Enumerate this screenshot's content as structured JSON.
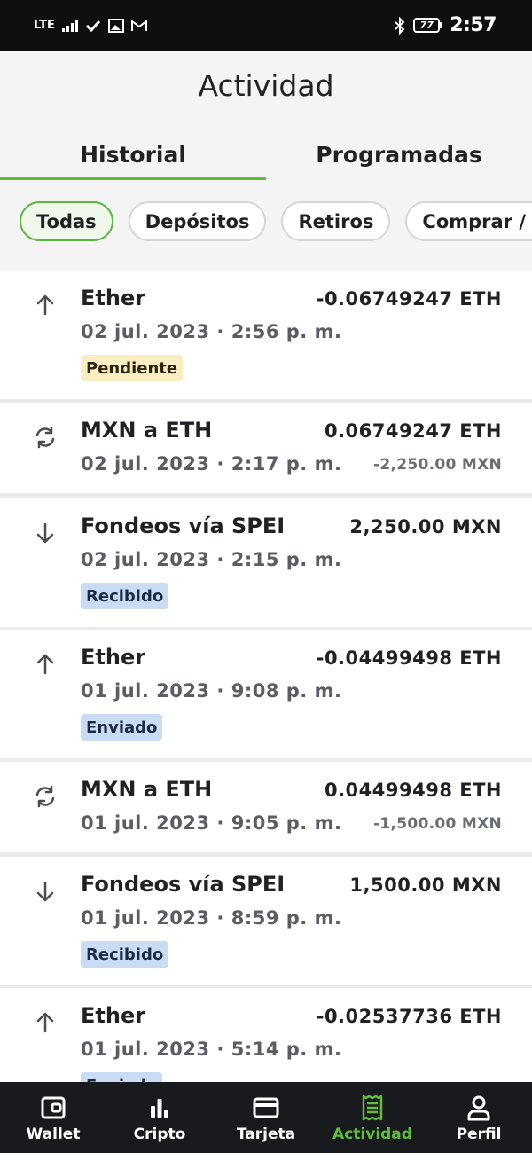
{
  "status_bar": {
    "network": "LTE",
    "battery": "77",
    "time": "2:57"
  },
  "header": {
    "title": "Actividad"
  },
  "tabs": [
    {
      "label": "Historial",
      "active": true
    },
    {
      "label": "Programadas",
      "active": false
    }
  ],
  "filters": [
    {
      "label": "Todas",
      "active": true
    },
    {
      "label": "Depósitos",
      "active": false
    },
    {
      "label": "Retiros",
      "active": false
    },
    {
      "label": "Comprar / Vender",
      "active": false
    }
  ],
  "transactions": [
    {
      "icon": "arrow-up-icon",
      "title": "Ether",
      "date": "02 jul. 2023 · 2:56 p. m.",
      "amount": "-0.06749247 ETH",
      "sub_amount": "",
      "status": "Pendiente"
    },
    {
      "icon": "exchange-icon",
      "title": "MXN a ETH",
      "date": "02 jul. 2023 · 2:17 p. m.",
      "amount": "0.06749247 ETH",
      "sub_amount": "-2,250.00 MXN",
      "status": ""
    },
    {
      "icon": "arrow-down-icon",
      "title": "Fondeos vía SPEI",
      "date": "02 jul. 2023 · 2:15 p. m.",
      "amount": "2,250.00 MXN",
      "sub_amount": "",
      "status": "Recibido"
    },
    {
      "icon": "arrow-up-icon",
      "title": "Ether",
      "date": "01 jul. 2023 · 9:08 p. m.",
      "amount": "-0.04499498 ETH",
      "sub_amount": "",
      "status": "Enviado"
    },
    {
      "icon": "exchange-icon",
      "title": "MXN a ETH",
      "date": "01 jul. 2023 · 9:05 p. m.",
      "amount": "0.04499498 ETH",
      "sub_amount": "-1,500.00 MXN",
      "status": ""
    },
    {
      "icon": "arrow-down-icon",
      "title": "Fondeos vía SPEI",
      "date": "01 jul. 2023 · 8:59 p. m.",
      "amount": "1,500.00 MXN",
      "sub_amount": "",
      "status": "Recibido"
    },
    {
      "icon": "arrow-up-icon",
      "title": "Ether",
      "date": "01 jul. 2023 · 5:14 p. m.",
      "amount": "-0.02537736 ETH",
      "sub_amount": "",
      "status": "Enviado"
    }
  ],
  "bottom_nav": [
    {
      "icon": "wallet-icon",
      "label": "Wallet",
      "active": false
    },
    {
      "icon": "chart-icon",
      "label": "Cripto",
      "active": false
    },
    {
      "icon": "card-icon",
      "label": "Tarjeta",
      "active": false
    },
    {
      "icon": "receipt-icon",
      "label": "Actividad",
      "active": true
    },
    {
      "icon": "profile-icon",
      "label": "Perfil",
      "active": false
    }
  ],
  "colors": {
    "accent": "#5fbf3b",
    "pending_badge": "#fbefc2",
    "info_badge": "#c9dcf6",
    "nav_background": "#191a1d"
  }
}
